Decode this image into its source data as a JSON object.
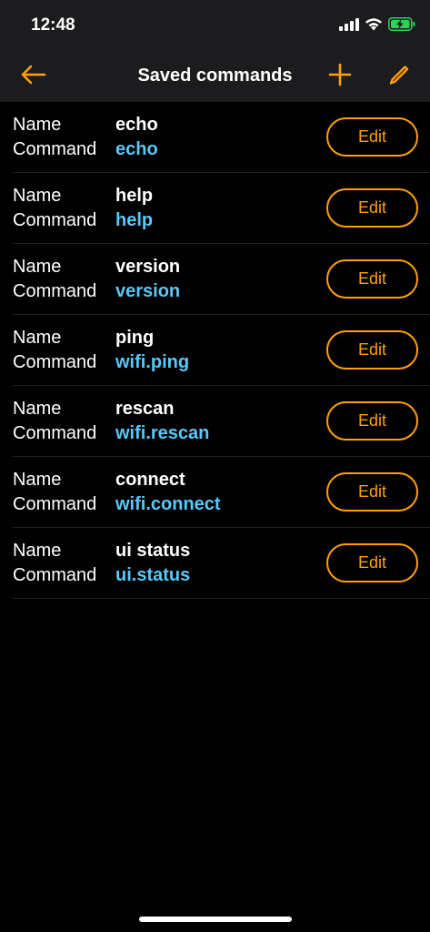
{
  "status_bar": {
    "time": "12:48",
    "icons": [
      "cellular-signal-icon",
      "wifi-icon",
      "battery-charging-icon"
    ]
  },
  "nav": {
    "title": "Saved commands",
    "back_icon": "arrow-left-icon",
    "add_icon": "plus-icon",
    "edit_icon": "pencil-icon"
  },
  "labels": {
    "name": "Name",
    "command": "Command",
    "edit": "Edit"
  },
  "commands": [
    {
      "name": "echo",
      "command": "echo"
    },
    {
      "name": "help",
      "command": "help"
    },
    {
      "name": "version",
      "command": "version"
    },
    {
      "name": "ping",
      "command": "wifi.ping"
    },
    {
      "name": "rescan",
      "command": "wifi.rescan"
    },
    {
      "name": "connect",
      "command": "wifi.connect"
    },
    {
      "name": "ui status",
      "command": "ui.status"
    }
  ],
  "colors": {
    "accent": "#ff9f0a",
    "command_text": "#5ac8fa",
    "bar_background": "#1c1c1e",
    "background": "#000000"
  }
}
